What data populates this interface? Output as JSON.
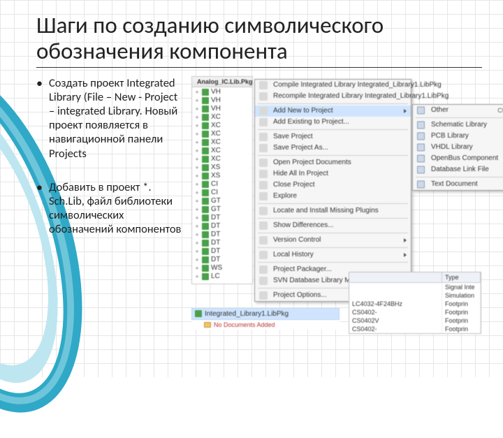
{
  "title": "Шаги по созданию символического обозначения компонента",
  "bullets": {
    "b1": "Создать проект Integrated Library (File – New - Project – integrated Library. Новый проект появляется в навигационной панели Projects",
    "b2": "Добавить в проект *. Sch.Lib, файл библиотеки символических обозначений компонентов"
  },
  "tree": {
    "header": "Analog_IC.Lib.Pkg",
    "items": [
      "VH",
      "VH",
      "VH",
      "XC",
      "XC",
      "XC",
      "XC",
      "XC",
      "XC",
      "XS",
      "XS",
      "CI",
      "CI",
      "GT",
      "GT",
      "DT",
      "DT",
      "DT",
      "DT",
      "DT",
      "DT",
      "WS",
      "LC"
    ]
  },
  "menu1": {
    "items": [
      {
        "label": "Compile Integrated Library Integrated_Library1.LibPkg"
      },
      {
        "label": "Recompile Integrated Library Integrated_Library1.LibPkg"
      },
      {
        "sep": true
      },
      {
        "label": "Add New to Project",
        "arrow": true,
        "hl": true
      },
      {
        "label": "Add Existing to Project..."
      },
      {
        "sep": true
      },
      {
        "label": "Save Project"
      },
      {
        "label": "Save Project As..."
      },
      {
        "sep": true
      },
      {
        "label": "Open Project Documents"
      },
      {
        "label": "Hide All In Project"
      },
      {
        "label": "Close Project"
      },
      {
        "label": "Explore"
      },
      {
        "sep": true
      },
      {
        "label": "Locate and Install Missing Plugins"
      },
      {
        "sep": true
      },
      {
        "label": "Show Differences..."
      },
      {
        "sep": true
      },
      {
        "label": "Version Control",
        "arrow": true
      },
      {
        "sep": true
      },
      {
        "label": "Local History",
        "arrow": true
      },
      {
        "sep": true
      },
      {
        "label": "Project Packager..."
      },
      {
        "label": "SVN Database Library Maker..."
      },
      {
        "sep": true
      },
      {
        "label": "Project Options..."
      }
    ]
  },
  "menu2": {
    "items": [
      {
        "label": "Other",
        "shortcut": "Ctrl+N"
      },
      {
        "sep": true
      },
      {
        "label": "Schematic Library"
      },
      {
        "label": "PCB Library"
      },
      {
        "label": "VHDL Library"
      },
      {
        "label": "OpenBus Component"
      },
      {
        "label": "Database Link File"
      },
      {
        "sep": true
      },
      {
        "label": "Text Document"
      }
    ]
  },
  "panel": {
    "col1_header": "",
    "col2_header": "Type",
    "rows": [
      {
        "a": "",
        "b": "Signal Inte"
      },
      {
        "a": "",
        "b": "Simulation"
      },
      {
        "a": "LC4032-4F24BHz",
        "b": "Footprin"
      },
      {
        "a": "CS0402-",
        "b": "Footprin"
      },
      {
        "a": "CS0402V",
        "b": "Footprin"
      },
      {
        "a": "CS0402-",
        "b": "Footprin"
      }
    ]
  },
  "selected_lib": {
    "name": "Integrated_Library1.LibPkg",
    "no_docs": "No Documents Added"
  }
}
